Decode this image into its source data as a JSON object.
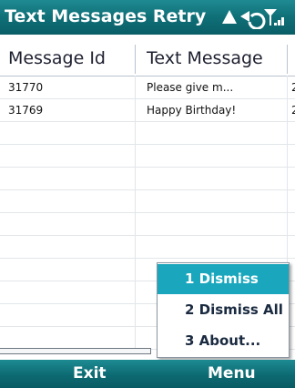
{
  "title_bar": {
    "title": "Text Messages Retry",
    "icons": [
      "notification-icon",
      "connectivity-icon",
      "signal-strength-icon"
    ]
  },
  "grid": {
    "columns": [
      "Message Id",
      "Text Message",
      ""
    ],
    "rows": [
      [
        "31770",
        "Please give m...",
        "2"
      ],
      [
        "31769",
        "Happy Birthday!",
        "2"
      ]
    ]
  },
  "menu": {
    "items": [
      "1 Dismiss",
      "2 Dismiss All",
      "3 About..."
    ],
    "selected_index": 0
  },
  "softkeys": {
    "left": "Exit",
    "right": "Menu"
  },
  "colors": {
    "title_bar": "#0f6f77",
    "menu_highlight": "#1aa7bd",
    "grid_lines": "#e2e6ea"
  }
}
